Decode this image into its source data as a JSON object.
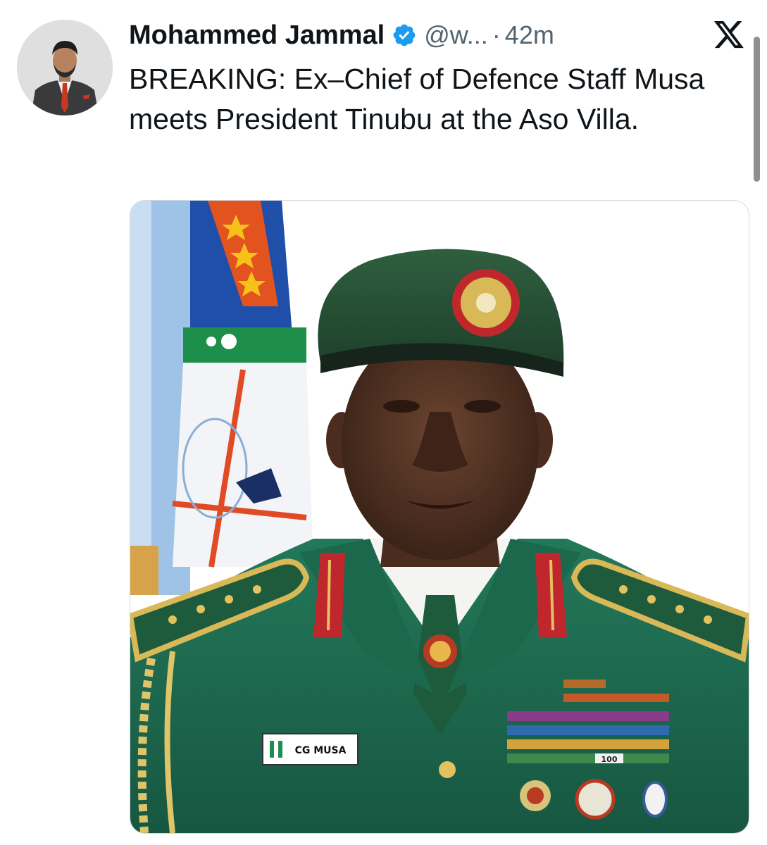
{
  "tweet": {
    "author": {
      "display_name": "Mohammed Jammal",
      "handle": "@w...",
      "verified": true,
      "avatar_icon": "profile-photo"
    },
    "separator": "·",
    "time": "42m",
    "platform_icon": "x-logo-icon",
    "text": "BREAKING: Ex–Chief of Defence Staff Musa meets President Tinubu at the Aso Villa.",
    "media": {
      "alt_icon": "portrait-photo",
      "name_tag": "CG MUSA",
      "ribbon_number": "100"
    }
  },
  "colors": {
    "verified_blue": "#1d9bf0",
    "text_primary": "#0f1419",
    "text_secondary": "#536471",
    "uniform_green": "#1f6b4e",
    "beret_green": "#234d33"
  }
}
